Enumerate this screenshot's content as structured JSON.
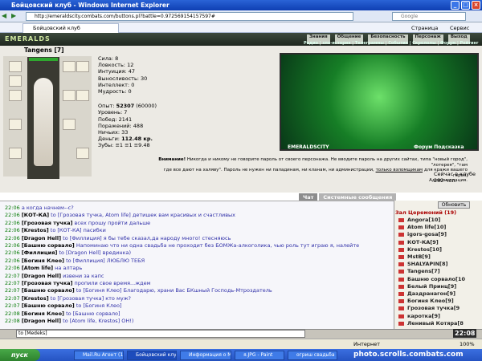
{
  "browser": {
    "title": "Бойцовский клуб - Windows Internet Explorer",
    "url": "http://emeraldscity.combats.com/buttons.pl?battle=0.972569154157597#",
    "search_placeholder": "Google",
    "tab_label": "Бойцовский клуб",
    "cmd_page": "Страница",
    "cmd_service": "Сервис",
    "status": "Интернет",
    "zoom": "100%"
  },
  "site": {
    "logo": "EMERALDS",
    "menu": [
      "Знания",
      "Общение",
      "Безопасность",
      "Персонаж",
      "Выход"
    ],
    "submenu": "Радио | зло-история | Телеграммы | События | Скрололы | Форум | Рейтинг"
  },
  "character": {
    "name": "Tangens",
    "level": "[7]",
    "stats": [
      {
        "label": "Сила",
        "value": "8"
      },
      {
        "label": "Ловкость",
        "value": "12"
      },
      {
        "label": "Интуиция",
        "value": "47"
      },
      {
        "label": "Выносливость",
        "value": "30"
      },
      {
        "label": "Интеллект",
        "value": "0"
      },
      {
        "label": "Мудрость",
        "value": "0"
      }
    ],
    "exp_label": "Опыт:",
    "exp": "52307",
    "exp_next": "(60000)",
    "records": [
      {
        "label": "Уровень",
        "value": "7"
      },
      {
        "label": "Побед",
        "value": "2141"
      },
      {
        "label": "Поражений",
        "value": "488"
      },
      {
        "label": "Ничьих",
        "value": "33"
      }
    ],
    "money_label": "Деньги:",
    "money": "112.48 кр.",
    "teeth_label": "Зубы:",
    "teeth": "≡1 ≡1 ≡9.48"
  },
  "scene": {
    "caption": "EMERALDSCITY",
    "links": "Форум   Подсказка"
  },
  "warning": {
    "title": "Внимание!",
    "text1": "Никогда и никому не говорите пароль от своего персонажа. Не вводите пароль на других сайтах, типа \"новый город\", \"лотерея\", \"там",
    "text2": "где все дают на халяву\". Пароль не нужен ни паладинам, ни кланам, ни администрации,",
    "link": "только взломщикам",
    "text3": "для кражи вашего героя.",
    "footer": "Администрация."
  },
  "online_text": "Сейчас в клубе 282 чел.",
  "chat": {
    "tabs": [
      "Чат",
      "Системные сообщения"
    ],
    "lines": [
      {
        "time": "22:06",
        "nick": "",
        "text": "а когда начнем--с?"
      },
      {
        "time": "22:06",
        "nick": "[КОТ-КА]",
        "text": "to [Грозовая тучка, Atom life] детишек вам красивых и счастливых"
      },
      {
        "time": "22:06",
        "nick": "[Грозовая тучка]",
        "text": "всех прошу пройти дальше"
      },
      {
        "time": "22:06",
        "nick": "[Krestos]",
        "text": "to [КОТ-КА] пасибки"
      },
      {
        "time": "22:06",
        "nick": "[Dragon Hell]",
        "text": "to [Филлиция] я бы тебе сказал,да народу много! стесняюсь"
      },
      {
        "time": "22:06",
        "nick": "[Башню сорвало]",
        "text": "Напоминаю что ни одна свадьба не проходит без БОМЖа-алкоголика, чью роль тут играю я, налейте"
      },
      {
        "time": "22:06",
        "nick": "[Филлиция]",
        "text": "to [Dragon Hell] врединка)"
      },
      {
        "time": "22:06",
        "nick": "[Богиня Клео]",
        "text": "to [Филлиция] ЛЮБЛЮ ТЕБЯ"
      },
      {
        "time": "22:06",
        "nick": "[Atom life]",
        "text": "на алтарь"
      },
      {
        "time": "22:07",
        "nick": "[Dragon Hell]",
        "text": "извени за капс"
      },
      {
        "time": "22:07",
        "nick": "[Грозовая тучка]",
        "text": "пропили свое время...ждем"
      },
      {
        "time": "22:07",
        "nick": "[Башню сорвало]",
        "text": "to [Богиня Клео] Благодарю, храни Вас БКшный Господь-Мтроздатель"
      },
      {
        "time": "22:07",
        "nick": "[Krestos]",
        "text": "to [Грозовая тучка] кто муж?"
      },
      {
        "time": "22:07",
        "nick": "[Башню сорвало]",
        "text": "to [Богиня Клео]"
      },
      {
        "time": "22:08",
        "nick": "[Богиня Клео]",
        "text": "to [Башню сорвало]"
      },
      {
        "time": "22:08",
        "nick": "[Dragon Hell]",
        "text": "to [Atom life, Krestos] ОН!)"
      }
    ],
    "input_value": "to [Medeks]"
  },
  "users": {
    "update_button": "Обновить",
    "header": "Зал Церемоний (19)",
    "list": [
      "Angora[10]",
      "Atom life[10]",
      "igors-gosa[9]",
      "КОТ-КА[9]",
      "Krestos[10]",
      "MstB[9]",
      "SHALYAPIN[8]",
      "Tangens[7]",
      "Башню сорвало[10",
      "Белый Принц[9]",
      "Даздранагон[9]",
      "Богиня Клео[9]",
      "Грозовая тучка[9",
      "каротка[9]",
      "Ленивый Котяра[8"
    ]
  },
  "clock": "22:08",
  "taskbar": {
    "start": "пуск",
    "tasks": [
      "Mail.Ru Агент (1 ...",
      "Бойцовский клуб ...",
      "Информация о М...",
      "я.JPG - Paint",
      "огриш свадьба"
    ]
  },
  "watermark": "photo.scrolls.combats.com"
}
